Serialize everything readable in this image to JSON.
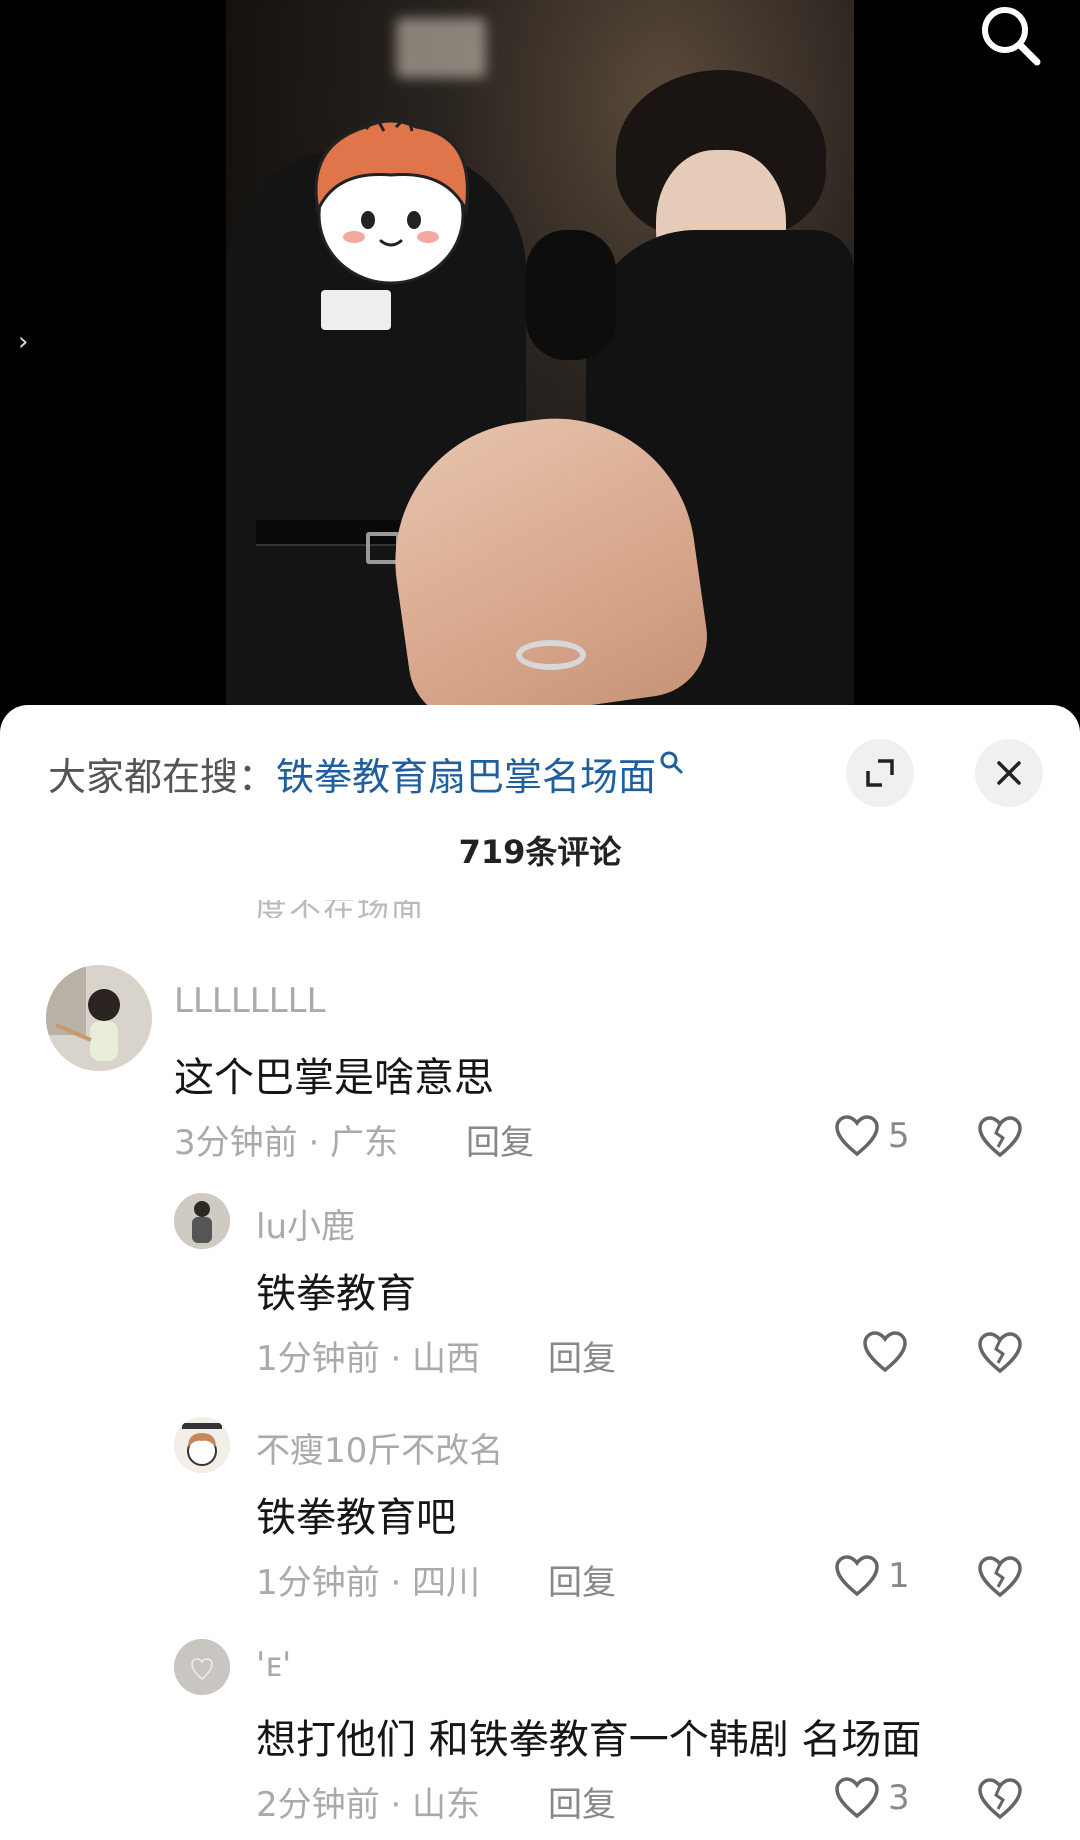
{
  "top_bar": {
    "search_icon": "search-icon",
    "side_arrow_icon": "chevron-right-icon"
  },
  "sheet": {
    "hot_search_prefix": "大家都在搜：",
    "hot_search_keyword": "铁拳教育扇巴掌名场面",
    "expand_icon": "expand-icon",
    "close_icon": "close-icon",
    "comment_count": "719条评论",
    "partial_text": "度不在场面"
  },
  "comments": [
    {
      "username": "LLLLLLLL",
      "text": "这个巴掌是啥意思",
      "meta": "3分钟前 · 广东",
      "reply": "回复",
      "likes": "5"
    },
    {
      "username": "lu小鹿",
      "text": "铁拳教育",
      "meta": "1分钟前 · 山西",
      "reply": "回复",
      "likes": ""
    },
    {
      "username": "不瘦10斤不改名",
      "text": "铁拳教育吧",
      "meta": "1分钟前 · 四川",
      "reply": "回复",
      "likes": "1"
    },
    {
      "username": "'ᴇ'",
      "text": "想打他们 和铁拳教育一个韩剧 名场面",
      "meta": "2分钟前 · 山东",
      "reply": "回复",
      "likes": "3"
    }
  ],
  "colors": {
    "keyword": "#1f5f9f",
    "muted": "#aaaaaa",
    "text": "#161616"
  }
}
